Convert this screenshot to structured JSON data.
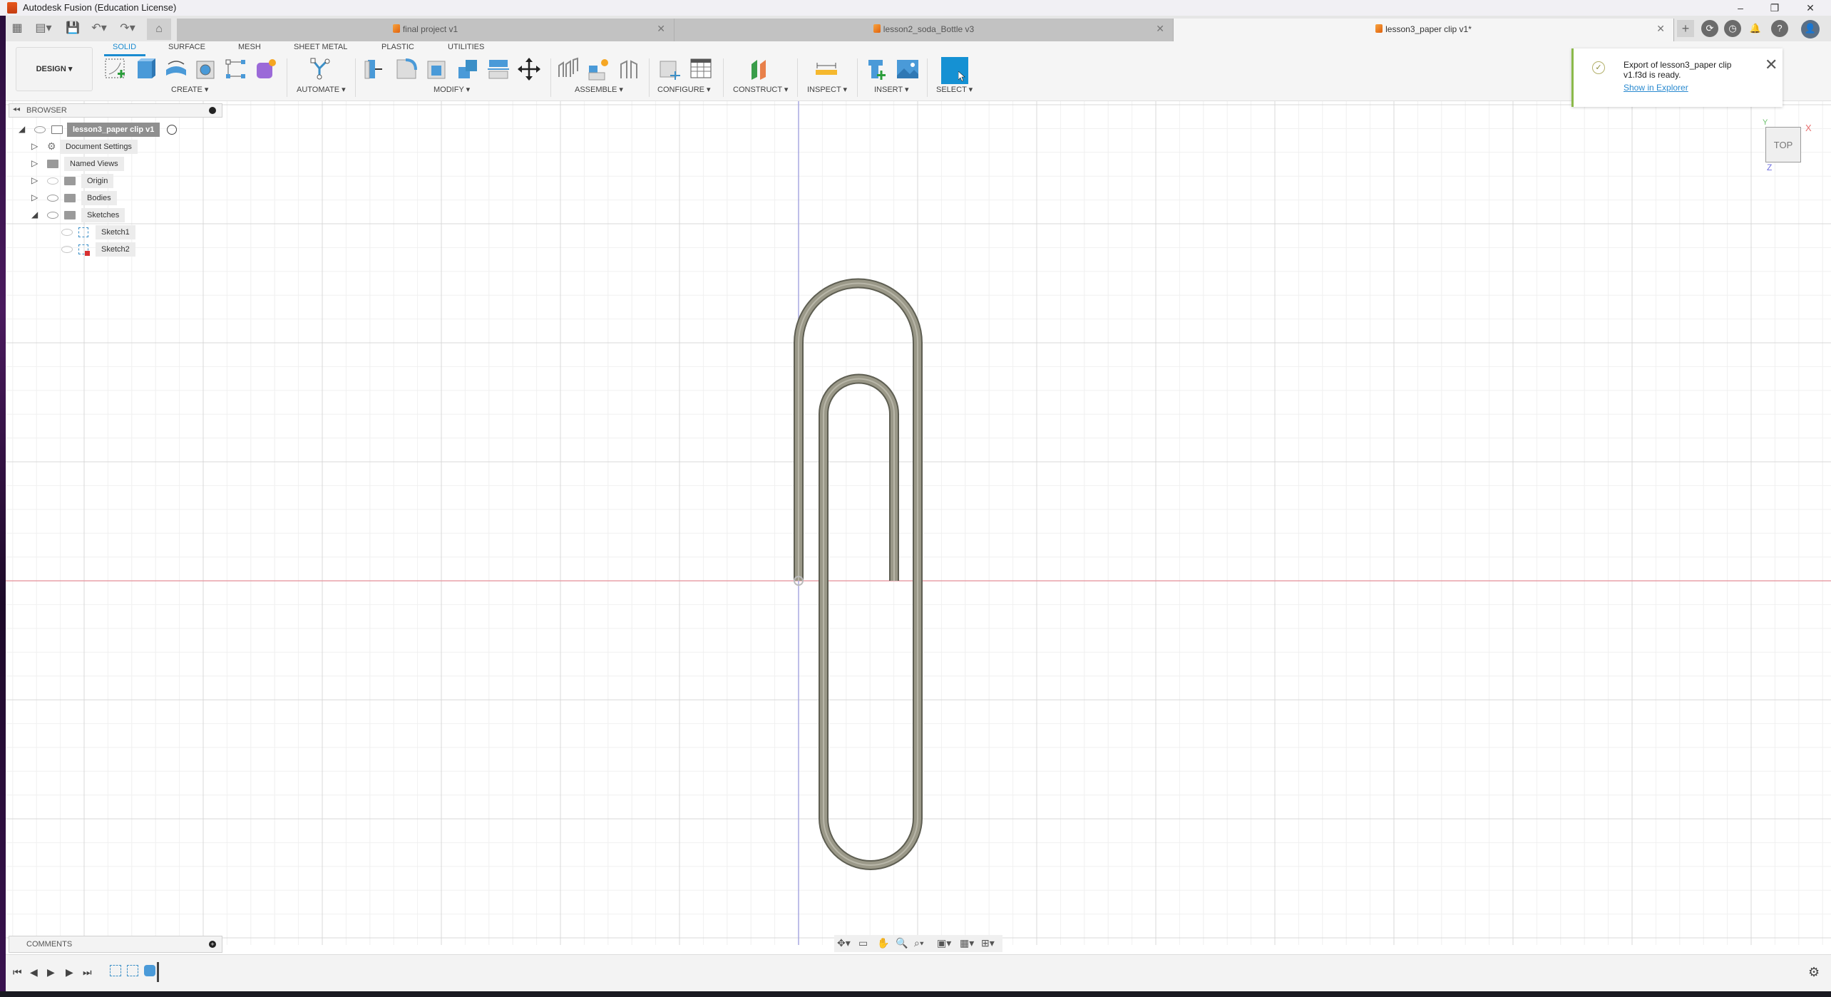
{
  "app": {
    "title": "Autodesk Fusion (Education License)",
    "window_controls": [
      "–",
      "❐",
      "✕"
    ]
  },
  "quick_access": {
    "grid_menu_icon": "▦",
    "file_icon": "▤▾",
    "save_icon": "💾",
    "undo_icon": "↶▾",
    "redo_icon": "↷▾",
    "home_icon": "⌂"
  },
  "doc_tabs": [
    {
      "label": "final project v1",
      "active": false
    },
    {
      "label": "lesson2_soda_Bottle v3",
      "active": false
    },
    {
      "label": "lesson3_paper clip v1*",
      "active": true
    }
  ],
  "tabbar_right": {
    "new_tab": "+",
    "extensions": "⟳",
    "job_status": "◷",
    "notifications": "🔔",
    "help": "?",
    "profile": "👤"
  },
  "workspace": {
    "mode_label": "DESIGN ▾",
    "tabs": [
      "SOLID",
      "SURFACE",
      "MESH",
      "SHEET METAL",
      "PLASTIC",
      "UTILITIES"
    ],
    "active_tab": "SOLID"
  },
  "tool_groups": {
    "create": "CREATE ▾",
    "automate": "AUTOMATE ▾",
    "modify": "MODIFY ▾",
    "assemble": "ASSEMBLE ▾",
    "configure": "CONFIGURE ▾",
    "construct": "CONSTRUCT ▾",
    "inspect": "INSPECT ▾",
    "insert": "INSERT ▾",
    "select": "SELECT ▾"
  },
  "notification": {
    "message": "Export of lesson3_paper clip v1.f3d is ready.",
    "link": "Show in Explorer",
    "close": "✕",
    "check": "✓"
  },
  "browser": {
    "title": "BROWSER",
    "root": "lesson3_paper clip v1",
    "items": [
      {
        "label": "Document Settings"
      },
      {
        "label": "Named Views"
      },
      {
        "label": "Origin"
      },
      {
        "label": "Bodies"
      },
      {
        "label": "Sketches"
      }
    ],
    "sketches": [
      {
        "label": "Sketch1"
      },
      {
        "label": "Sketch2"
      }
    ]
  },
  "comments": {
    "title": "COMMENTS",
    "add": "+"
  },
  "viewcube": {
    "face": "TOP",
    "axis_x": "X",
    "axis_y": "Y",
    "axis_z": "Z"
  },
  "navbar": {
    "orbit": "✥▾",
    "look_at": "▭",
    "pan": "✋",
    "zoom": "🔍",
    "fit": "⌕▾",
    "display": "▣▾",
    "grid": "▦▾",
    "viewports": "⊞▾"
  },
  "timeline": {
    "first": "⏮",
    "prev": "◀",
    "play": "▶",
    "next": "▶",
    "last": "⏭",
    "settings": "⚙"
  },
  "colors": {
    "accent": "#1a8bd0",
    "select_tile": "#1591d3",
    "x_axis": "#e8a0a8",
    "z_axis": "#a8a8e0",
    "wire": "#8a8a7a",
    "notif_bar": "#8bb94a"
  }
}
